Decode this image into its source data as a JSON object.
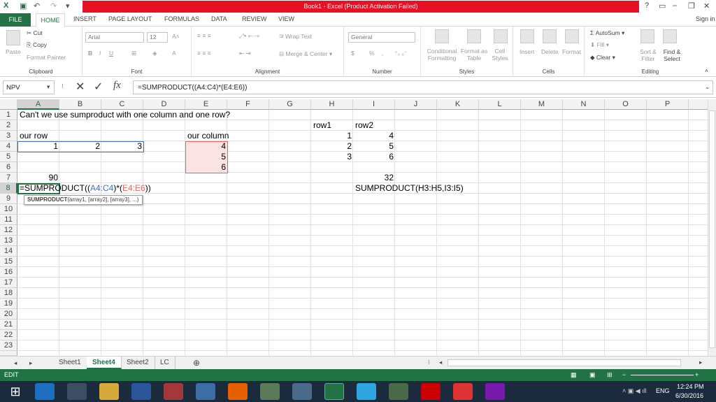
{
  "window": {
    "title": "Book1 -  Excel (Product Activation Failed)",
    "help": "?",
    "signin": "Sign in"
  },
  "tabs": [
    "FILE",
    "HOME",
    "INSERT",
    "PAGE LAYOUT",
    "FORMULAS",
    "DATA",
    "REVIEW",
    "VIEW"
  ],
  "ribbon": {
    "clipboard": {
      "label": "Clipboard",
      "paste": "Paste",
      "cut": "Cut",
      "copy": "Copy",
      "format_painter": "Format Painter"
    },
    "font": {
      "label": "Font",
      "name": "Arial",
      "size": "12",
      "bold": "B",
      "italic": "I",
      "underline": "U"
    },
    "alignment": {
      "label": "Alignment",
      "wrap": "Wrap Text",
      "merge": "Merge & Center"
    },
    "number": {
      "label": "Number",
      "format": "General",
      "currency": "$",
      "percent": "%",
      "comma": ","
    },
    "styles": {
      "label": "Styles",
      "conditional": "Conditional Formatting",
      "format_table": "Format as Table",
      "cell_styles": "Cell Styles"
    },
    "cells": {
      "label": "Cells",
      "insert": "Insert",
      "delete": "Delete",
      "format": "Format"
    },
    "editing": {
      "label": "Editing",
      "autosum": "AutoSum",
      "fill": "Fill",
      "clear": "Clear",
      "sort": "Sort & Filter",
      "find": "Find & Select"
    }
  },
  "formula_bar": {
    "namebox": "NPV",
    "formula": "=SUMPRODUCT((A4:C4)*(E4:E6))",
    "fx": "fx"
  },
  "columns": [
    "A",
    "B",
    "C",
    "D",
    "E",
    "F",
    "G",
    "H",
    "I",
    "J",
    "K",
    "L",
    "M",
    "N",
    "O",
    "P"
  ],
  "rows": [
    "1",
    "2",
    "3",
    "4",
    "5",
    "6",
    "7",
    "8",
    "9",
    "10",
    "11",
    "12",
    "13",
    "14",
    "15",
    "16",
    "17",
    "18",
    "19",
    "20",
    "21",
    "22",
    "23"
  ],
  "cells": {
    "a1": "Can't we use sumproduct with one column and one row?",
    "a3": "our row",
    "e3": "our column",
    "h2": "row1",
    "i2": "row2",
    "a4": "1",
    "b4": "2",
    "c4": "3",
    "e4": "4",
    "e5": "5",
    "e6": "6",
    "h3": "1",
    "h4": "2",
    "h5": "3",
    "i3": "4",
    "i4": "5",
    "i5": "6",
    "a7": "90",
    "i7": "32",
    "a8_pre": "=SUMPRODUCT((",
    "a8_r1": "A4:C4",
    ")": ")",
    "a8_mul": "*(",
    "a8_r2": "E4:E6",
    "a8_post": "))",
    "i8": "SUMPRODUCT(H3:H5,I3:I5)",
    "tooltip_fn": "SUMPRODUCT",
    "tooltip_args": "(array1, [array2], [array3], ...)"
  },
  "sheets": [
    "Sheet1",
    "Sheet4",
    "Sheet2",
    "LC"
  ],
  "status": {
    "mode": "EDIT"
  },
  "taskbar": {
    "time": "12:24 PM",
    "date": "6/30/2016",
    "lang": "ENG"
  }
}
